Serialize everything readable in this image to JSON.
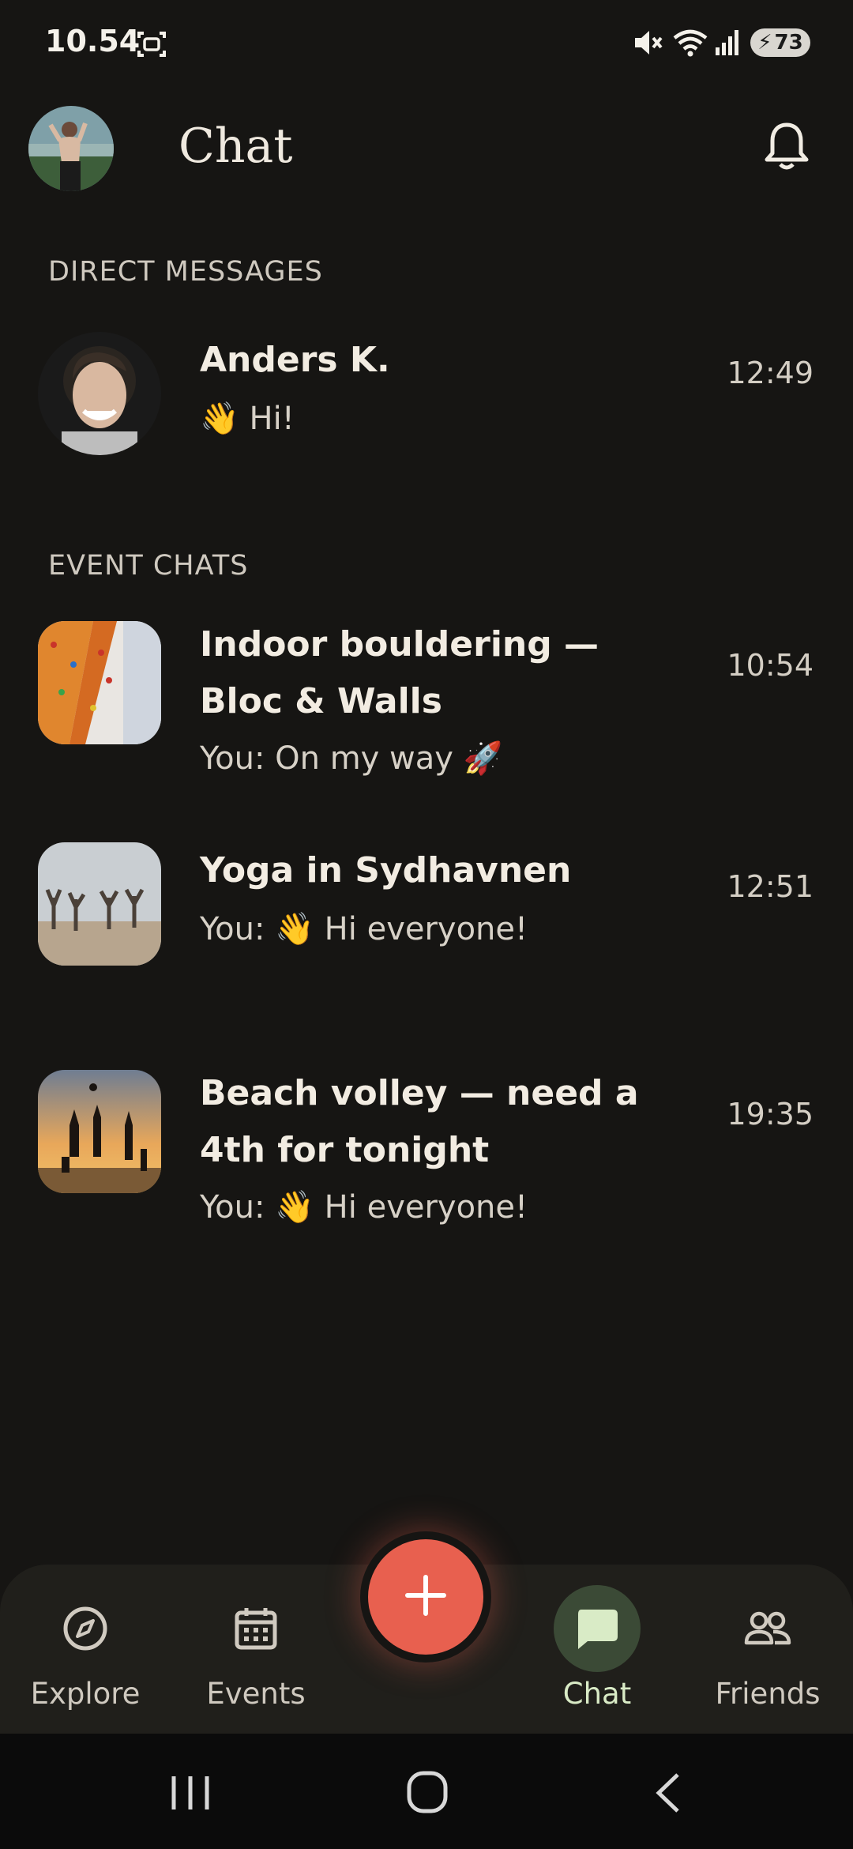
{
  "status_bar": {
    "time": "10.54",
    "battery": "73",
    "icons": [
      "screenshot-icon",
      "mute-icon",
      "wifi-icon",
      "signal-icon",
      "battery-icon"
    ]
  },
  "header": {
    "title": "Chat"
  },
  "direct_messages": {
    "label": "DIRECT MESSAGES",
    "items": [
      {
        "name": "Anders K.",
        "emoji": "👋",
        "preview": "Hi!",
        "time": "12:49"
      }
    ]
  },
  "event_chats": {
    "label": "EVENT CHATS",
    "items": [
      {
        "title": "Indoor bouldering — Bloc & Walls",
        "prefix": "You: ",
        "preview": "On my way",
        "emoji": "🚀",
        "time": "10:54"
      },
      {
        "title": "Yoga in Sydhavnen",
        "prefix": "You: ",
        "emoji": "👋",
        "preview": "Hi everyone!",
        "time": "12:51"
      },
      {
        "title": "Beach volley — need a 4th for tonight",
        "prefix": "You: ",
        "emoji": "👋",
        "preview": "Hi everyone!",
        "time": "19:35"
      }
    ]
  },
  "bottom_nav": {
    "items": [
      {
        "label": "Explore",
        "icon": "compass-icon"
      },
      {
        "label": "Events",
        "icon": "calendar-icon"
      },
      {
        "label": "Chat",
        "icon": "chat-bubble-icon",
        "active": true
      },
      {
        "label": "Friends",
        "icon": "people-icon"
      }
    ],
    "fab_icon": "plus-icon"
  },
  "system_nav": {
    "icons": [
      "recent-apps-icon",
      "home-icon",
      "back-icon"
    ]
  },
  "colors": {
    "background": "#161513",
    "accent": "#e8604f",
    "active_nav": "#3b4a36",
    "nav_bar": "#201f1b"
  }
}
